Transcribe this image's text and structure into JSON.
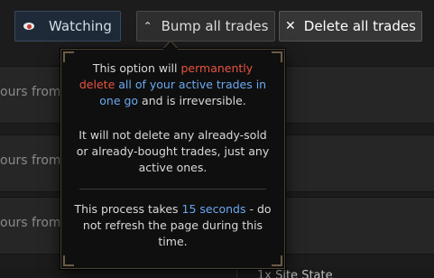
{
  "toolbar": {
    "watching_label": "Watching",
    "bump_label": "Bump all trades",
    "delete_label": "Delete all trades"
  },
  "rows": [
    {
      "text": "ours from n"
    },
    {
      "text": "ours from n"
    },
    {
      "text": "ours from n"
    }
  ],
  "bottom": {
    "text": "1x Site State"
  },
  "tooltip": {
    "p1_a": "This option will ",
    "p1_red": "permanently delete",
    "p1_b": " ",
    "p1_blue": "all of your active trades in one go",
    "p1_c": " and is irreversible.",
    "p2": "It will not delete any already-sold or already-bought trades, just any active ones.",
    "p3_a": "This process takes ",
    "p3_blue": "15 seconds",
    "p3_b": " - do not refresh the page during this time."
  },
  "colors": {
    "warning_red": "#e8533f",
    "highlight_blue": "#6aa9f0",
    "tooltip_border": "#4b4234"
  },
  "icons": {
    "watching": "eye-icon",
    "bump": "chevron-up-icon",
    "delete": "close-icon"
  }
}
